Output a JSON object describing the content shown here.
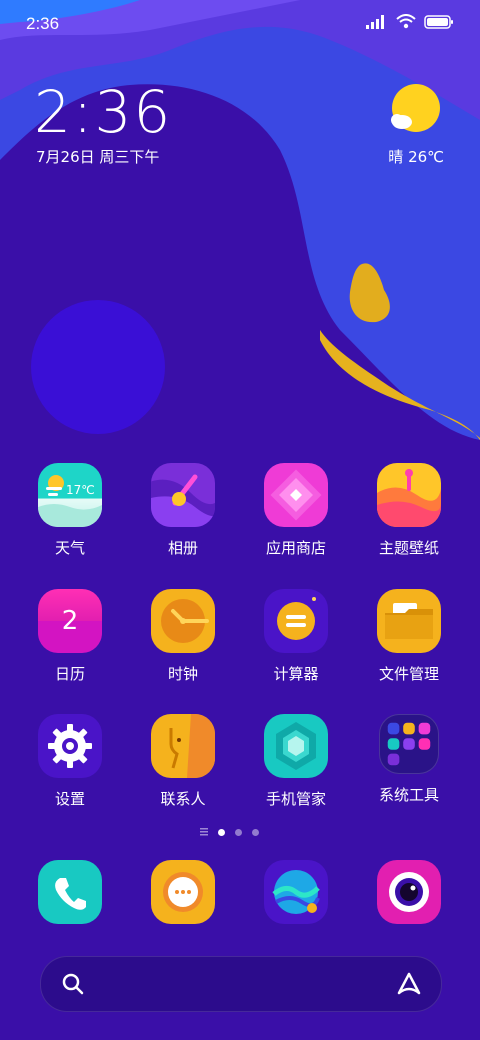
{
  "status_bar": {
    "time": "2:36"
  },
  "lock_widget": {
    "time": "2:36",
    "date": "7月26日 周三下午",
    "weather": "晴 26℃"
  },
  "apps": [
    {
      "label": "天气",
      "icon": "weather-icon",
      "badge_text": "17℃"
    },
    {
      "label": "相册",
      "icon": "gallery-icon"
    },
    {
      "label": "应用商店",
      "icon": "app-store-icon"
    },
    {
      "label": "主题壁纸",
      "icon": "theme-icon"
    },
    {
      "label": "日历",
      "icon": "calendar-icon",
      "badge_text": "2"
    },
    {
      "label": "时钟",
      "icon": "clock-icon"
    },
    {
      "label": "计算器",
      "icon": "calculator-icon"
    },
    {
      "label": "文件管理",
      "icon": "folder-icon"
    },
    {
      "label": "设置",
      "icon": "settings-icon"
    },
    {
      "label": "联系人",
      "icon": "contacts-icon"
    },
    {
      "label": "手机管家",
      "icon": "phone-manager-icon"
    },
    {
      "label": "系统工具",
      "icon": "system-tools-folder-icon"
    }
  ],
  "dock": [
    {
      "icon": "phone-icon"
    },
    {
      "icon": "messages-icon"
    },
    {
      "icon": "browser-icon"
    },
    {
      "icon": "camera-icon"
    }
  ],
  "page_indicator": {
    "pages": 3,
    "current": 1
  },
  "colors": {
    "wallpaper_dark": "#3a0fa8",
    "wallpaper_blue": "#3a4be6",
    "wallpaper_yellow": "#e6b21e",
    "sun": "#ffd21f"
  }
}
